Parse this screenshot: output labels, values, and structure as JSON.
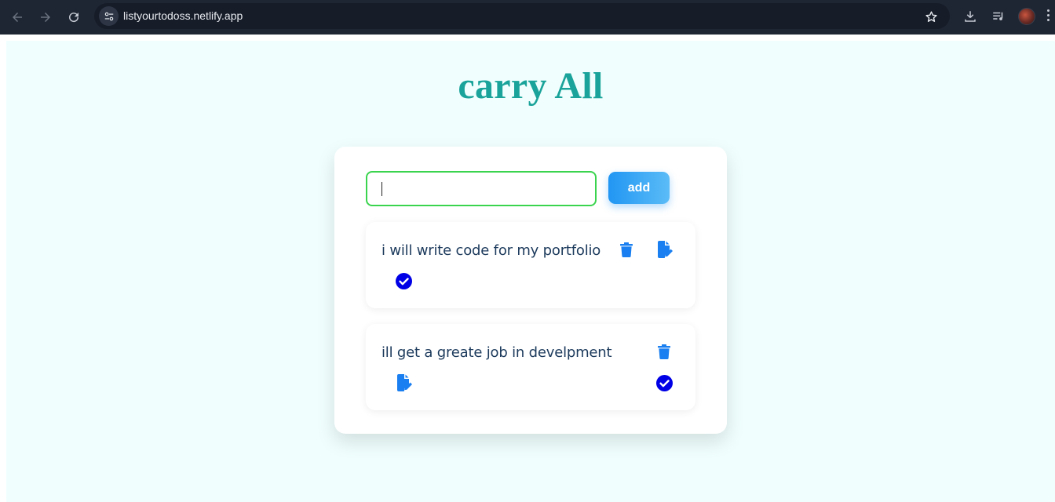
{
  "browser": {
    "url": "listyourtodoss.netlify.app"
  },
  "app": {
    "title": "carry All",
    "input": {
      "value": "",
      "placeholder": ""
    },
    "add_label": "add"
  },
  "todos": [
    {
      "text": "i will write code for my portfolio",
      "completed": true
    },
    {
      "text": "ill get a greate job in develpment",
      "completed": true
    }
  ],
  "icons": {
    "back": "arrow-left-icon",
    "forward": "arrow-right-icon",
    "reload": "reload-icon",
    "site_info": "tune-icon",
    "bookmark": "star-icon",
    "download": "download-icon",
    "media": "queue-music-icon",
    "delete": "trash-icon",
    "edit": "file-pen-icon",
    "complete": "check-circle-icon"
  },
  "colors": {
    "title": "#1aa39a",
    "input_border": "#3ad44e",
    "add_button": "#2196f3",
    "icon_blue": "#1a7ff0",
    "check": "#0000e6",
    "todo_text": "#1c3a5c",
    "page_bg": "#f0fffe"
  }
}
